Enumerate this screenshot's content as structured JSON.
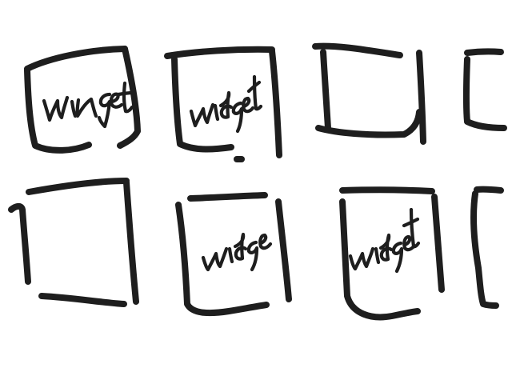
{
  "sketch": {
    "ink_color": "#1e1e1e",
    "background": "#ffffff",
    "boxes": [
      {
        "name": "box-row1-col1",
        "label": "widget"
      },
      {
        "name": "box-row1-col2",
        "label": "widget"
      },
      {
        "name": "box-row1-col3",
        "label": ""
      },
      {
        "name": "box-row1-col4",
        "label": ""
      },
      {
        "name": "box-row2-col1",
        "label": ""
      },
      {
        "name": "box-row2-col2",
        "label": "widge"
      },
      {
        "name": "box-row2-col3",
        "label": "widget"
      },
      {
        "name": "box-row2-col4",
        "label": ""
      }
    ]
  }
}
